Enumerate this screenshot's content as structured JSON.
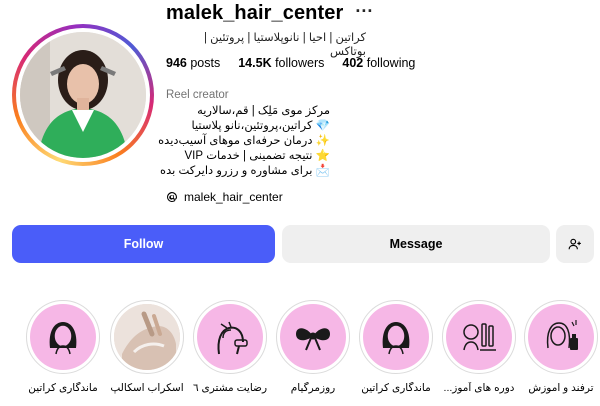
{
  "profile": {
    "username": "malek_hair_center",
    "more_icon": "ellipsis-icon",
    "category_line": "کراتین | احیا | نانوپلاستیا | پروتئین | بوتاکس",
    "stats": {
      "posts_value": "946",
      "posts_label": "posts",
      "followers_value": "14.5K",
      "followers_label": "followers",
      "following_value": "402",
      "following_label": "following"
    },
    "creator_label": "Reel creator",
    "bio_lines": [
      "مرکز موی مَلِک | قم،سالاریه",
      "💎 کراتین،پروتئین،نانو پلاستیا",
      "✨ درمان حرفه‌ای موهای آسیب‌دیده",
      "⭐ نتیجه تضمینی | خدمات VIP",
      "📩 برای مشاوره و رزرو دایرکت بده"
    ],
    "threads_handle": "malek_hair_center"
  },
  "actions": {
    "follow_label": "Follow",
    "message_label": "Message",
    "add_user_icon": "add-user-icon"
  },
  "highlights": [
    {
      "label": "ماندگاری کراتین",
      "icon": "woman-face-icon"
    },
    {
      "label": "اسکراب اسکالپ",
      "icon": "photo"
    },
    {
      "label": "رضایت مشتری ٦",
      "icon": "hair-dryer-icon"
    },
    {
      "label": "روزمرگیام",
      "icon": "bow-icon"
    },
    {
      "label": "ماندگاری کراتین",
      "icon": "woman-face-icon"
    },
    {
      "label": "دوره های آموز...",
      "icon": "hair-tools-icon"
    },
    {
      "label": "ترفند و اموزش",
      "icon": "woman-product-icon"
    }
  ],
  "colors": {
    "follow_button": "#4a5df9",
    "secondary_button": "#efefef",
    "highlight_fill": "#f6b7e6"
  }
}
